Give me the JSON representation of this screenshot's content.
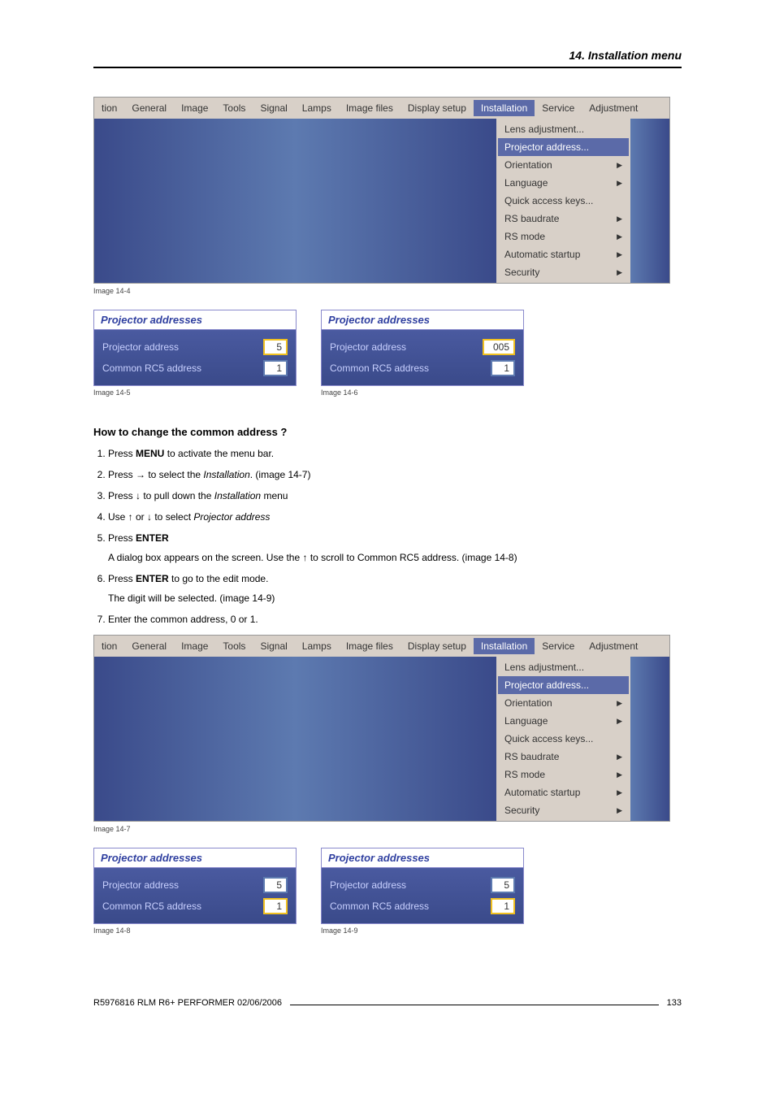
{
  "header": {
    "title": "14.  Installation menu"
  },
  "menubar": {
    "items": [
      "tion",
      "General",
      "Image",
      "Tools",
      "Signal",
      "Lamps",
      "Image files",
      "Display setup",
      "Installation",
      "Service",
      "Adjustment"
    ],
    "active": "Installation"
  },
  "dropdown": {
    "items": [
      {
        "label": "Lens adjustment...",
        "arrow": false
      },
      {
        "label": "Projector address...",
        "arrow": false,
        "active": true
      },
      {
        "label": "Orientation",
        "arrow": true
      },
      {
        "label": "Language",
        "arrow": true
      },
      {
        "label": "Quick access keys...",
        "arrow": false
      },
      {
        "label": "RS baudrate",
        "arrow": true
      },
      {
        "label": "RS mode",
        "arrow": true
      },
      {
        "label": "Automatic startup",
        "arrow": true
      },
      {
        "label": "Security",
        "arrow": true
      }
    ]
  },
  "captions": {
    "img14_4": "Image 14-4",
    "img14_5": "Image 14-5",
    "img14_6": "Image 14-6",
    "img14_7": "Image 14-7",
    "img14_8": "Image 14-8",
    "img14_9": "Image 14-9"
  },
  "dialog": {
    "title": "Projector addresses",
    "row_proj": "Projector address",
    "row_rc5": "Common RC5 address",
    "d1": {
      "proj": "5",
      "rc5": "1"
    },
    "d2": {
      "proj": "005",
      "rc5": "1"
    },
    "d3": {
      "proj": "5",
      "rc5": "1"
    },
    "d4": {
      "proj": "5",
      "rc5": "1"
    }
  },
  "section": {
    "heading": "How to change the common address ?",
    "steps": [
      {
        "pre": "Press ",
        "bold": "MENU",
        "post": " to activate the menu bar."
      },
      {
        "pre": "Press → to select the ",
        "ital": "Installation",
        "post": ".  (image 14-7)"
      },
      {
        "pre": "Press ↓ to pull down the ",
        "ital": "Installation",
        "post": " menu"
      },
      {
        "pre": "Use ↑ or ↓ to select ",
        "ital": "Projector address",
        "post": ""
      },
      {
        "pre": "Press ",
        "bold": "ENTER",
        "post": "",
        "sub": "A dialog box appears on the screen.  Use the ↑ to scroll to Common RC5 address. (image 14-8)"
      },
      {
        "pre": "Press ",
        "bold": "ENTER",
        "post": " to go to the edit mode.",
        "sub": "The digit will be selected.  (image 14-9)"
      },
      {
        "pre": "Enter the common address, 0 or 1.",
        "bold": "",
        "post": ""
      }
    ]
  },
  "footer": {
    "left": "R5976816  RLM R6+ PERFORMER  02/06/2006",
    "right": "133"
  }
}
